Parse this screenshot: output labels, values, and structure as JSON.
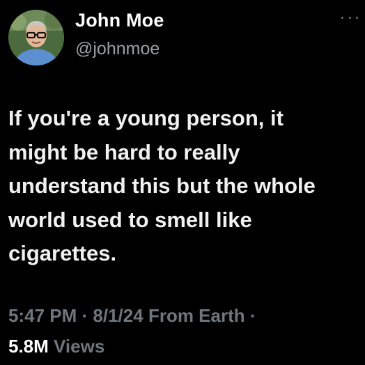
{
  "author": {
    "display_name": "John Moe",
    "handle": "@johnmoe",
    "avatar_icon": "user-avatar"
  },
  "menu": {
    "icon": "more-options-icon"
  },
  "tweet": {
    "text": "If you're a young person, it might be hard to really understand this but the whole world used to smell like cigarettes."
  },
  "meta": {
    "time": "5:47 PM",
    "date": "8/1/24",
    "location": "From Earth",
    "separator": "·"
  },
  "stats": {
    "views_count": "5.8M",
    "views_label": "Views"
  },
  "colors": {
    "background": "#000000",
    "primary_text": "#ffffff",
    "secondary_text": "#6e767d"
  }
}
